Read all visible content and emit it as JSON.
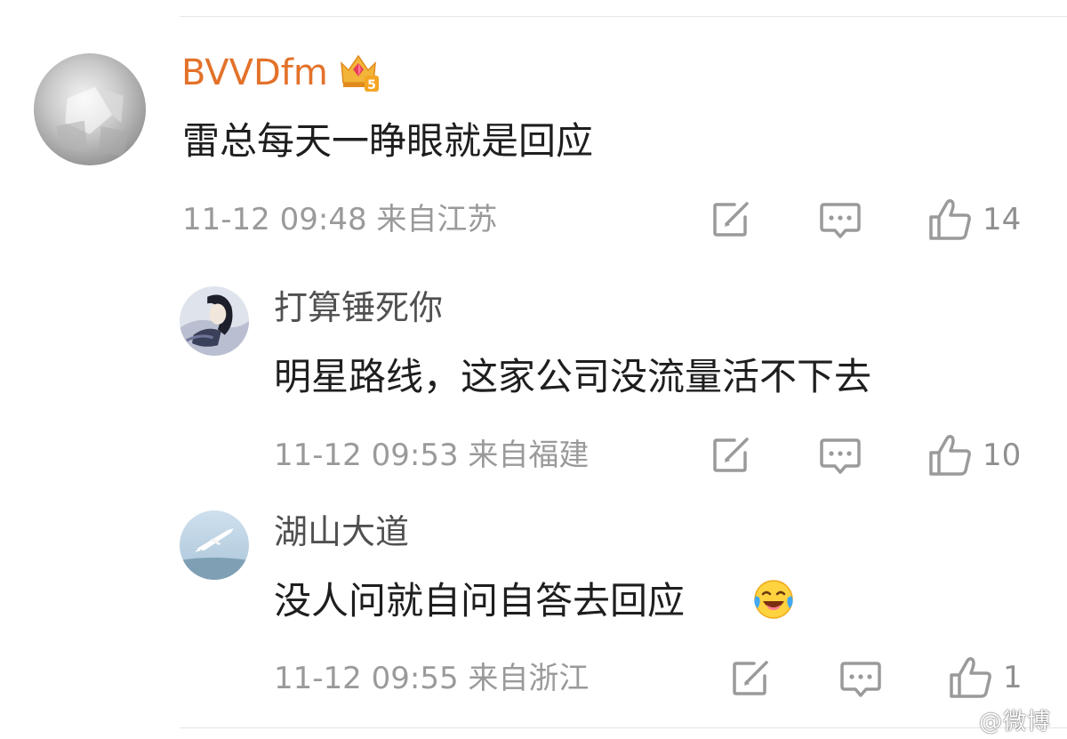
{
  "comments": [
    {
      "username": "BVVDfm",
      "text": "雷总每天一睁眼就是回应",
      "meta": "11-12 09:48 来自江苏",
      "like_count": "14",
      "badge_icon": "crown-level-badge",
      "badge_level": "5"
    },
    {
      "username": "打算锤死你",
      "text": "明星路线，这家公司没流量活不下去",
      "meta": "11-12 09:53 来自福建",
      "like_count": "10"
    },
    {
      "username": "湖山大道",
      "text": "没人问就自问自答去回应",
      "meta": "11-12 09:55 来自浙江",
      "like_count": "1",
      "emoji_icon": "laugh-cry-emoji"
    }
  ],
  "watermark": "@微博",
  "colors": {
    "primary_username": "#e3722a",
    "reply_username": "#505050",
    "meta": "#9a9a9a",
    "icon": "#9a9a9a"
  }
}
